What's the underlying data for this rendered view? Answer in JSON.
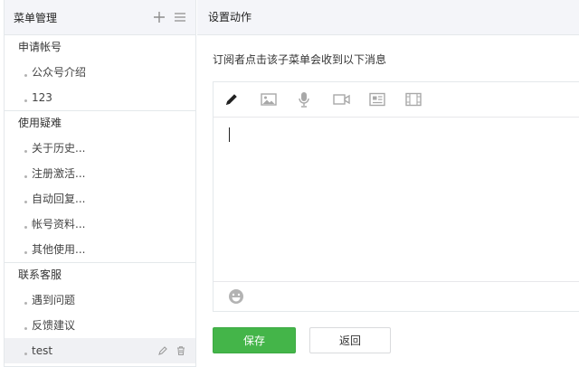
{
  "menu_panel": {
    "title": "菜单管理",
    "add_icon": "plus-icon",
    "sort_icon": "list-icon",
    "groups": [
      {
        "label": "申请帐号",
        "items": [
          "公众号介绍",
          "123"
        ]
      },
      {
        "label": "使用疑难",
        "items": [
          "关于历史...",
          "注册激活...",
          "自动回复...",
          "帐号资料...",
          "其他使用..."
        ]
      },
      {
        "label": "联系客服",
        "items": [
          "遇到问题",
          "反馈建议",
          "test"
        ]
      }
    ],
    "active_item": "test"
  },
  "action_panel": {
    "title": "设置动作",
    "description": "订阅者点击该子菜单会收到以下消息",
    "toolbar": [
      "pencil-icon",
      "image-icon",
      "microphone-icon",
      "video-icon",
      "news-icon",
      "film-icon"
    ],
    "emoji_icon": "smiley-icon"
  },
  "buttons": {
    "save": "保存",
    "back": "返回"
  },
  "colors": {
    "accent": "#44b549",
    "header_bg": "#f4f5f9",
    "border": "#e4e8eb"
  }
}
